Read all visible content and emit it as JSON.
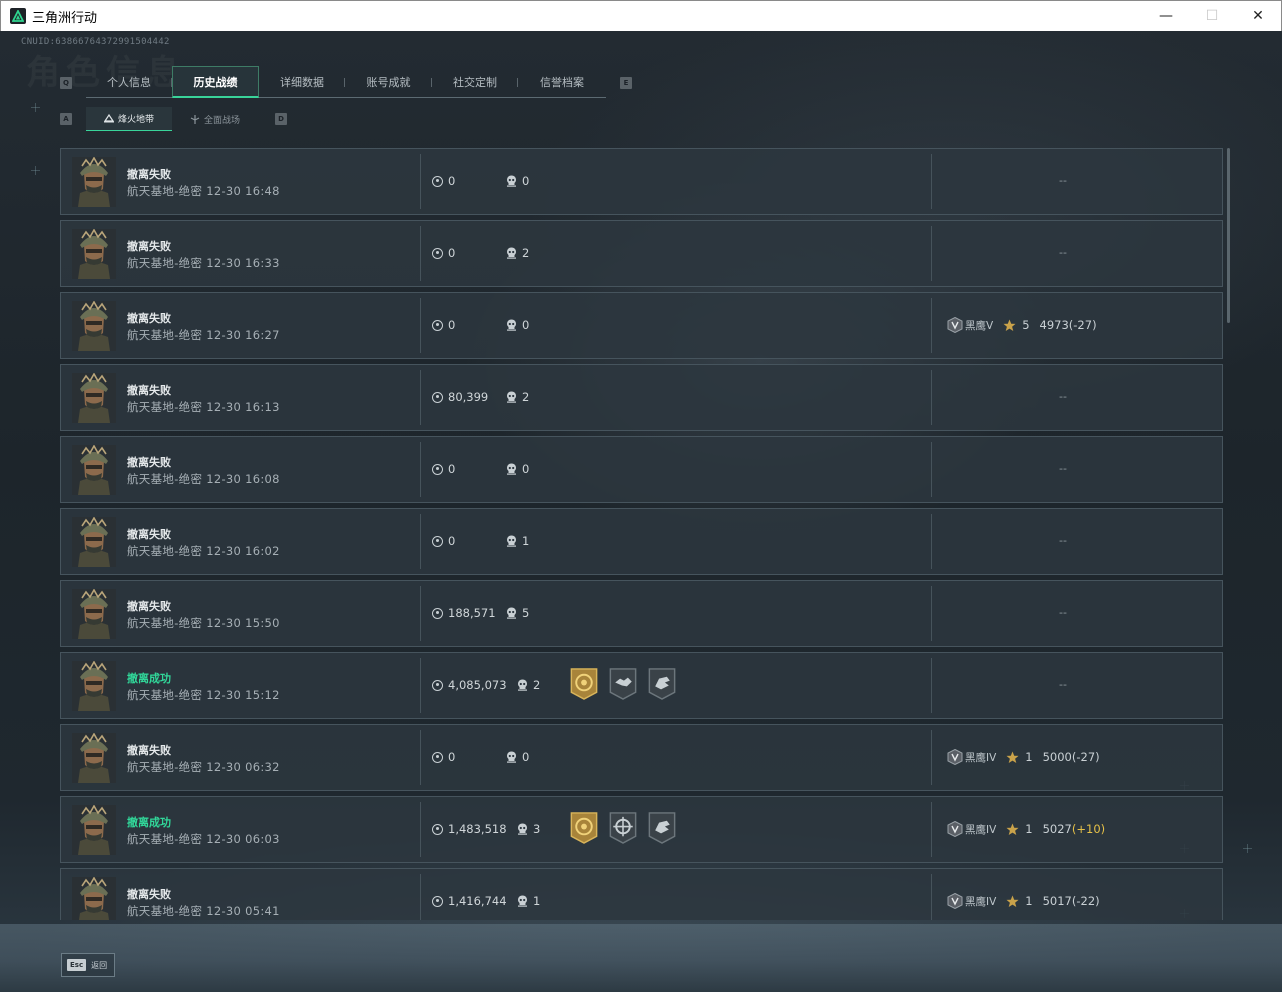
{
  "window": {
    "title": "三角洲行动",
    "minimize_glyph": "—",
    "maximize_glyph": "☐",
    "close_glyph": "✕"
  },
  "header": {
    "uid": "CNUID:6386676437299150444​2",
    "watermark": "角色信息",
    "key_prev_tab": "Q",
    "key_next_tab": "E",
    "key_prev_sub": "A",
    "key_next_sub": "D"
  },
  "tabs": [
    {
      "label": "个人信息",
      "active": false
    },
    {
      "label": "历史战绩",
      "active": true
    },
    {
      "label": "详细数据",
      "active": false
    },
    {
      "label": "账号成就",
      "active": false
    },
    {
      "label": "社交定制",
      "active": false
    },
    {
      "label": "信誉档案",
      "active": false
    }
  ],
  "subtabs": [
    {
      "label": "烽火地带",
      "active": true
    },
    {
      "label": "全面战场",
      "active": false
    }
  ],
  "matches": [
    {
      "result": "撤离失败",
      "success": false,
      "map": "航天基地-绝密",
      "time": "12-30 16:48",
      "money": "0",
      "kills": "0",
      "badges": [],
      "rank": null,
      "dash": "--"
    },
    {
      "result": "撤离失败",
      "success": false,
      "map": "航天基地-绝密",
      "time": "12-30 16:33",
      "money": "0",
      "kills": "2",
      "badges": [],
      "rank": null,
      "dash": "--"
    },
    {
      "result": "撤离失败",
      "success": false,
      "map": "航天基地-绝密",
      "time": "12-30 16:27",
      "money": "0",
      "kills": "0",
      "badges": [],
      "rank": {
        "name": "黑鹰V",
        "stars": "5",
        "score": "4973",
        "delta": "(-27)",
        "positive": false
      },
      "dash": ""
    },
    {
      "result": "撤离失败",
      "success": false,
      "map": "航天基地-绝密",
      "time": "12-30 16:13",
      "money": "80,399",
      "kills": "2",
      "badges": [],
      "rank": null,
      "dash": "--"
    },
    {
      "result": "撤离失败",
      "success": false,
      "map": "航天基地-绝密",
      "time": "12-30 16:08",
      "money": "0",
      "kills": "0",
      "badges": [],
      "rank": null,
      "dash": "--"
    },
    {
      "result": "撤离失败",
      "success": false,
      "map": "航天基地-绝密",
      "time": "12-30 16:02",
      "money": "0",
      "kills": "1",
      "badges": [],
      "rank": null,
      "dash": "--"
    },
    {
      "result": "撤离失败",
      "success": false,
      "map": "航天基地-绝密",
      "time": "12-30 15:50",
      "money": "188,571",
      "kills": "5",
      "badges": [],
      "rank": null,
      "dash": "--"
    },
    {
      "result": "撤离成功",
      "success": true,
      "map": "航天基地-绝密",
      "time": "12-30 15:12",
      "money": "4,085,073",
      "kills": "2",
      "badges": [
        "gold-medal-badge",
        "handshake-badge",
        "hand-badge"
      ],
      "rank": null,
      "dash": "--"
    },
    {
      "result": "撤离失败",
      "success": false,
      "map": "航天基地-绝密",
      "time": "12-30 06:32",
      "money": "0",
      "kills": "0",
      "badges": [],
      "rank": {
        "name": "黑鹰IV",
        "stars": "1",
        "score": "5000",
        "delta": "(-27)",
        "positive": false
      },
      "dash": ""
    },
    {
      "result": "撤离成功",
      "success": true,
      "map": "航天基地-绝密",
      "time": "12-30 06:03",
      "money": "1,483,518",
      "kills": "3",
      "badges": [
        "gold-medal-badge",
        "crosshair-badge",
        "hand-badge"
      ],
      "rank": {
        "name": "黑鹰IV",
        "stars": "1",
        "score": "5027",
        "delta": "(+10)",
        "positive": true
      },
      "dash": ""
    },
    {
      "result": "撤离失败",
      "success": false,
      "map": "航天基地-绝密",
      "time": "12-30 05:41",
      "money": "1,416,744",
      "kills": "1",
      "badges": [],
      "rank": {
        "name": "黑鹰IV",
        "stars": "1",
        "score": "5017",
        "delta": "(-22)",
        "positive": false
      },
      "dash": ""
    }
  ],
  "footer": {
    "esc_label": "Esc",
    "back_label": "返回"
  },
  "colors": {
    "accent": "#39d49a",
    "success_text": "#31d89a",
    "positive_delta": "#e5c048",
    "gold_badge": "#c9a24a"
  }
}
